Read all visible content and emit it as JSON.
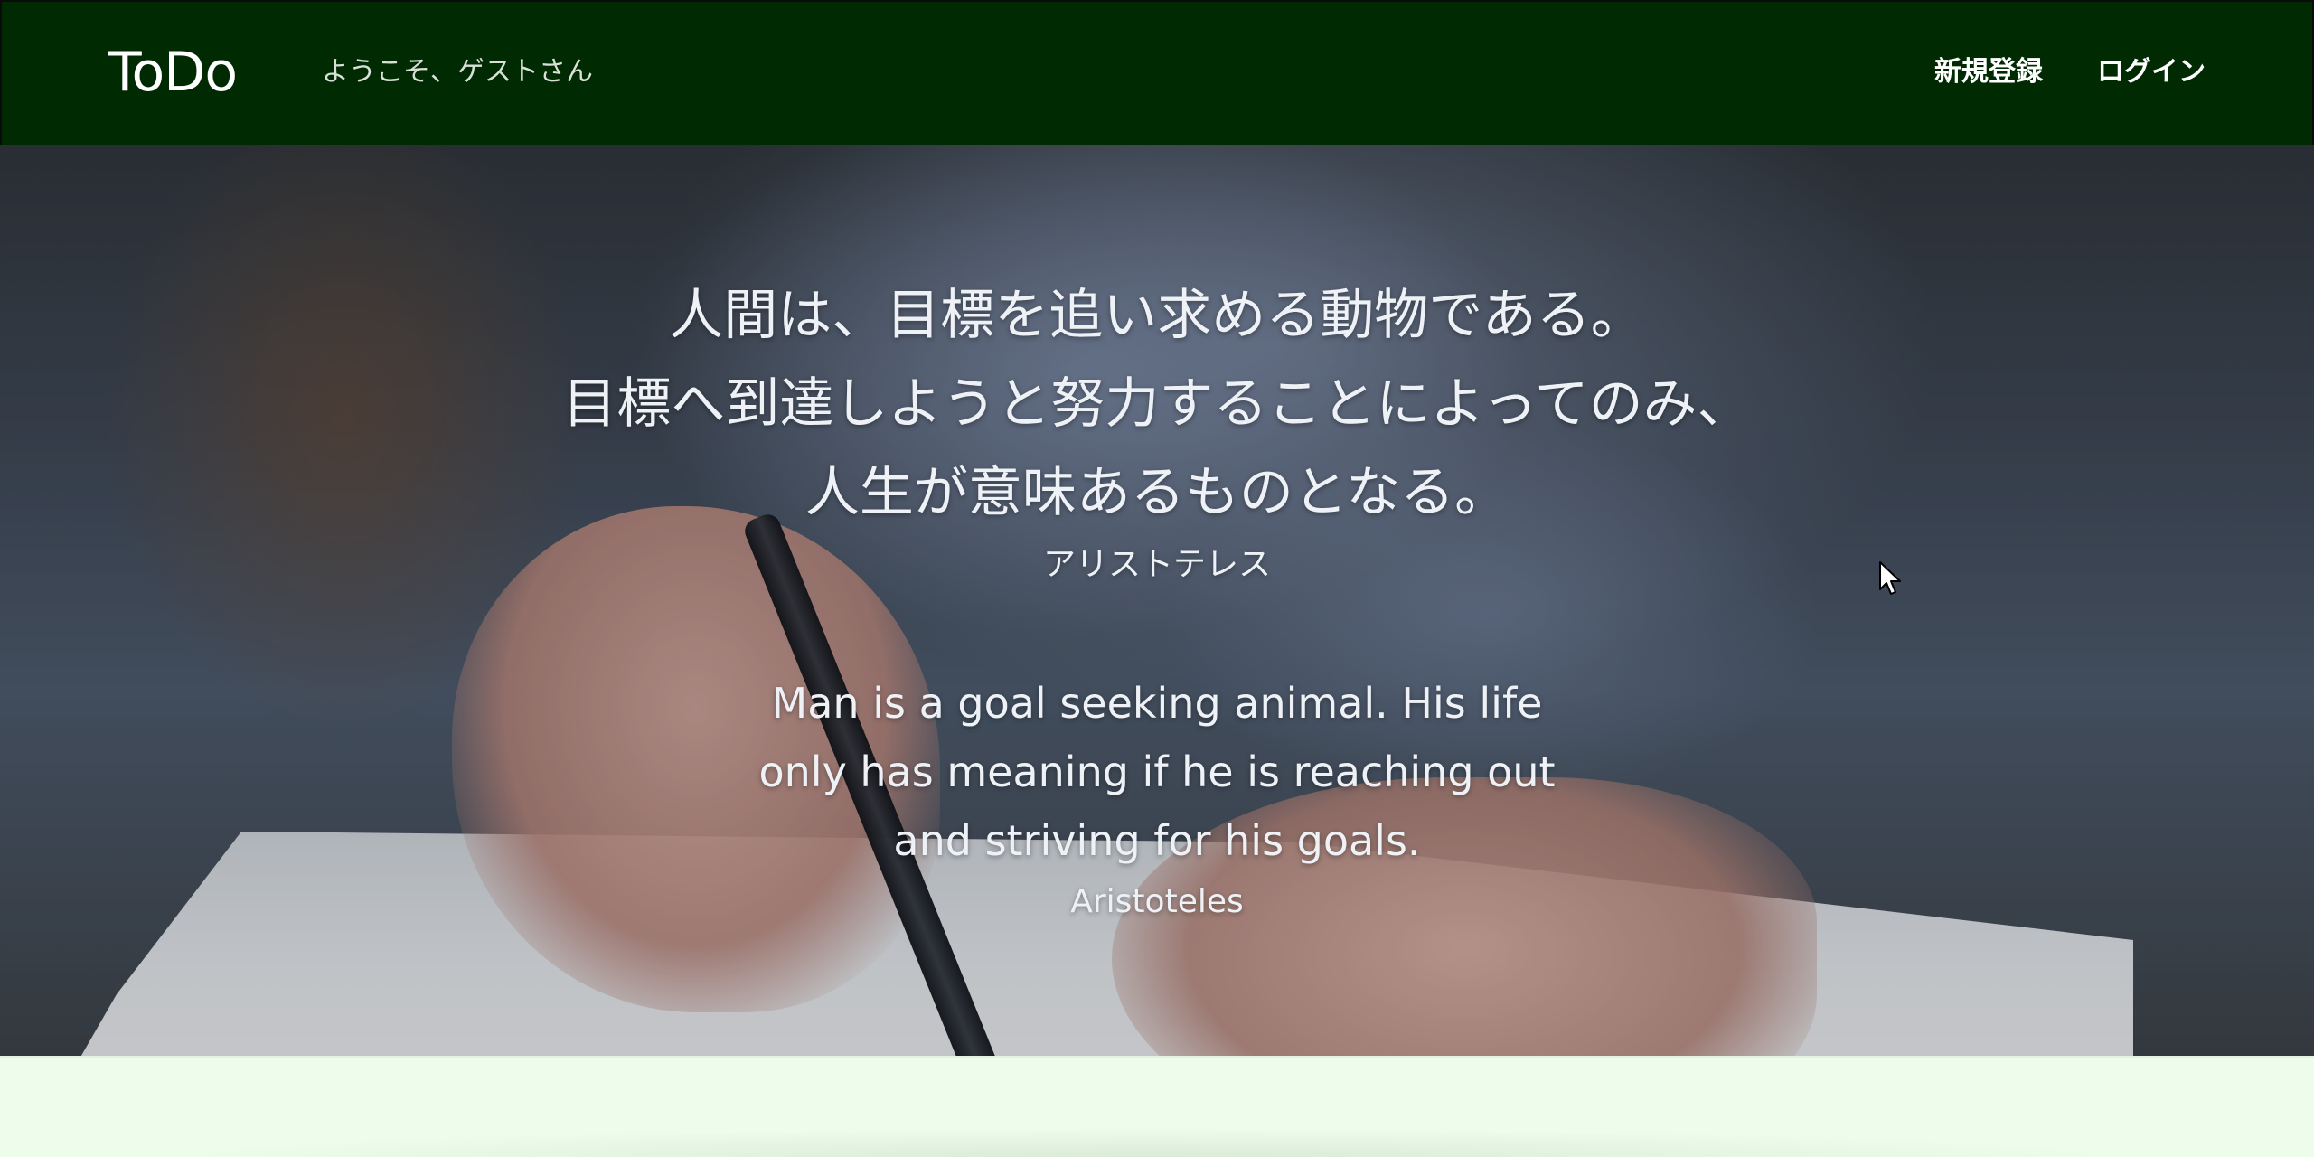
{
  "header": {
    "brand": "ToDo",
    "welcome_text": "ようこそ、ゲストさん",
    "nav": {
      "signup_label": "新規登録",
      "login_label": "ログイン"
    }
  },
  "hero": {
    "quote_ja_lines": [
      "人間は、目標を追い求める動物である。",
      "目標へ到達しようと努力することによってのみ、",
      "人生が意味あるものとなる。"
    ],
    "author_ja": "アリストテレス",
    "quote_en_lines": [
      "Man is a goal seeking animal. His life",
      "only has meaning if he is reaching out",
      "and striving for his goals."
    ],
    "author_en": "Aristoteles"
  },
  "colors": {
    "header_bg": "#002b02",
    "page_bg": "#eefdeb",
    "text_light": "#eef2f6"
  },
  "icons": {
    "cursor": "mouse-pointer-icon"
  }
}
